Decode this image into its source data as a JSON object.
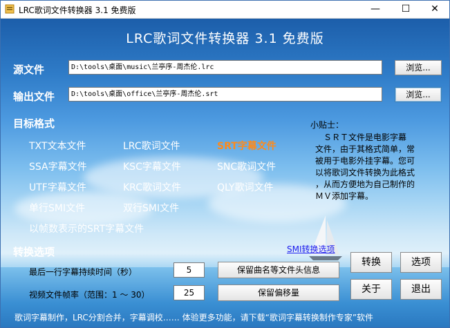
{
  "window": {
    "title": "LRC歌词文件转换器 3.1 免费版",
    "controls": {
      "minimize": "—",
      "maximize": "☐",
      "close": "✕"
    }
  },
  "header": {
    "app_title": "LRC歌词文件转换器 3.1 免费版"
  },
  "source": {
    "label": "源文件",
    "value": "D:\\tools\\桌面\\music\\兰亭序-周杰伦.lrc",
    "browse_label": "浏览..."
  },
  "output": {
    "label": "输出文件",
    "value": "D:\\tools\\桌面\\office\\兰亭序-周杰伦.srt",
    "browse_label": "浏览..."
  },
  "formats": {
    "label": "目标格式",
    "selected": "SRT字幕文件",
    "items": [
      "TXT文本文件",
      "LRC歌词文件",
      "SRT字幕文件",
      "SSA字幕文件",
      "KSC字幕文件",
      "SNC歌词文件",
      "UTF字幕文件",
      "KRC歌词文件",
      "QLY歌词文件",
      "单行SMI文件",
      "双行SMI文件",
      "以帧数表示的SRT字幕文件"
    ]
  },
  "tip": {
    "title": "小贴士：",
    "lines": [
      "　ＳＲＴ文件是电影字幕",
      "文件，由于其格式简单，常",
      "被用于电影外挂字幕。您可",
      "以将歌词文件转换为此格式",
      "，从而方便地为自己制作的",
      "ＭＶ添加字幕。"
    ]
  },
  "options": {
    "label": "转换选项",
    "smi_link": "SMI转换选项",
    "last_duration_label": "最后一行字幕持续时间（秒）",
    "last_duration_value": "5",
    "frame_rate_label": "视频文件帧率（范围：1 ～ 30）",
    "frame_rate_value": "25",
    "keep_header_label": "保留曲名等文件头信息",
    "keep_offset_label": "保留偏移量"
  },
  "actions": {
    "convert": "转换",
    "options": "选项",
    "about": "关于",
    "exit": "退出"
  },
  "footer": {
    "text": "歌词字幕制作，LRC分割合并，字幕调校…… 体验更多功能，请下载“歌词字幕转换制作专家”软件"
  },
  "colors": {
    "selected_format": "#ff8a1a",
    "label": "#ffffff",
    "link": "#1a1aee"
  }
}
